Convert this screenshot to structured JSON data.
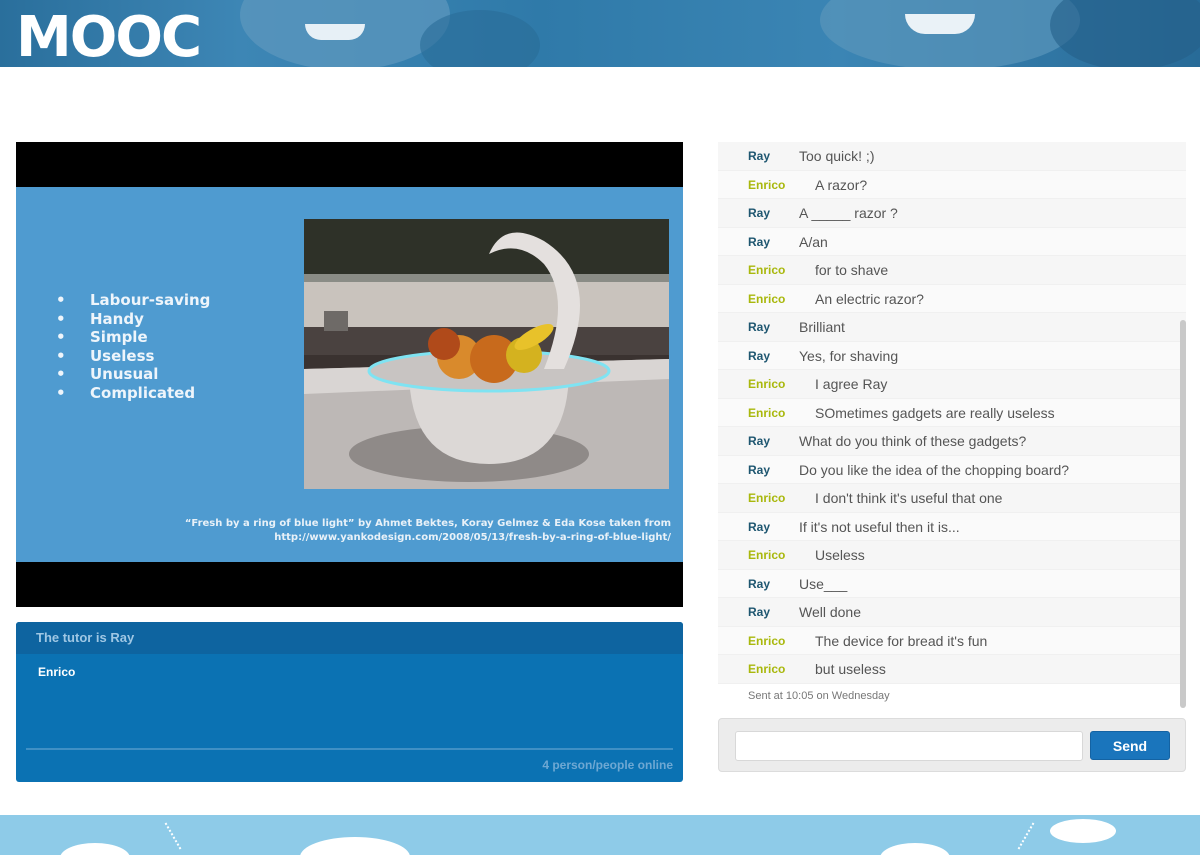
{
  "app": {
    "title": "MOOC"
  },
  "video": {
    "bullets": [
      "Labour-saving",
      "Handy",
      "Simple",
      "Useless",
      "Unusual",
      "Complicated"
    ],
    "caption_line1": "“Fresh by a ring of blue light” by Ahmet Bektes, Koray Gelmez & Eda Kose taken from",
    "caption_line2": "http://www.yankodesign.com/2008/05/13/fresh-by-a-ring-of-blue-light/"
  },
  "participants": {
    "header": "The tutor is Ray",
    "users": [
      "Enrico"
    ],
    "online_text": "4 person/people online"
  },
  "chat": {
    "messages": [
      {
        "sender": "Ray",
        "text": "Too quick! ;)"
      },
      {
        "sender": "Enrico",
        "text": "A razor?"
      },
      {
        "sender": "Ray",
        "text": "A _____ razor ?"
      },
      {
        "sender": "Ray",
        "text": "A/an"
      },
      {
        "sender": "Enrico",
        "text": "for to shave"
      },
      {
        "sender": "Enrico",
        "text": "An electric razor?"
      },
      {
        "sender": "Ray",
        "text": "Brilliant"
      },
      {
        "sender": "Ray",
        "text": "Yes, for shaving"
      },
      {
        "sender": "Enrico",
        "text": "I agree Ray"
      },
      {
        "sender": "Enrico",
        "text": "SOmetimes gadgets are really useless"
      },
      {
        "sender": "Ray",
        "text": "What do you think of these gadgets?"
      },
      {
        "sender": "Ray",
        "text": "Do you like the idea of the chopping board?"
      },
      {
        "sender": "Enrico",
        "text": "I don't think it's useful that one"
      },
      {
        "sender": "Ray",
        "text": "If it's not useful then it is..."
      },
      {
        "sender": "Enrico",
        "text": "Useless"
      },
      {
        "sender": "Ray",
        "text": "Use___"
      },
      {
        "sender": "Ray",
        "text": "Well done"
      },
      {
        "sender": "Enrico",
        "text": "The device for bread it's fun"
      },
      {
        "sender": "Enrico",
        "text": "but useless"
      }
    ],
    "sent_info": "Sent at 10:05 on Wednesday",
    "input_value": "",
    "send_label": "Send"
  },
  "colors": {
    "ray": "#1e5670",
    "enrico": "#a9b80d",
    "accent": "#1a75bc",
    "panel": "#0b72b3",
    "slide": "#4f9bd0"
  }
}
